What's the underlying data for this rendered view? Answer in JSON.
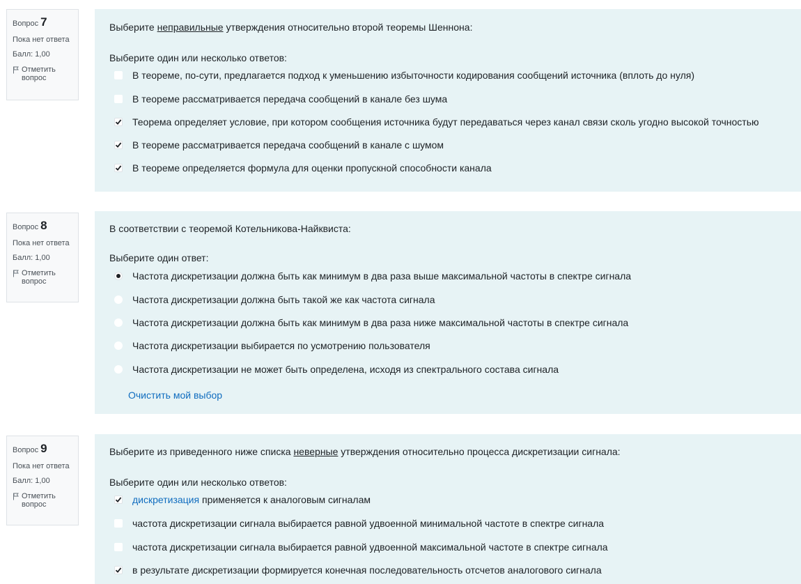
{
  "q7": {
    "question_word": "Вопрос",
    "number": "7",
    "status": "Пока нет ответа",
    "mark": "Балл: 1,00",
    "flag_line1": "Отметить",
    "flag_line2": "вопрос",
    "text_before": "Выберите ",
    "text_underlined": "неправильные",
    "text_after": " утверждения относительно второй теоремы Шеннона:",
    "prompt": "Выберите один или несколько ответов:",
    "options": [
      {
        "label": "В теореме, по-сути, предлагается подход к уменьшению избыточности кодирования сообщений источника (вплоть до нуля)",
        "checked": false
      },
      {
        "label": "В теореме рассматривается передача сообщений в канале без шума",
        "checked": false
      },
      {
        "label": "Теорема определяет условие, при котором сообщения источника будут передаваться через канал связи сколь угодно высокой точностью",
        "checked": true
      },
      {
        "label": "В теореме рассматривается передача сообщений в канале с шумом",
        "checked": true
      },
      {
        "label": "В теореме определяется формула для оценки пропускной способности канала",
        "checked": true
      }
    ]
  },
  "q8": {
    "question_word": "Вопрос",
    "number": "8",
    "status": "Пока нет ответа",
    "mark": "Балл: 1,00",
    "flag_line1": "Отметить",
    "flag_line2": "вопрос",
    "text": "В соответствии с теоремой Котельникова-Найквиста:",
    "prompt": "Выберите один ответ:",
    "options": [
      {
        "label": "Частота дискретизации должна быть как минимум в два раза выше максимальной частоты в спектре сигнала",
        "checked": true
      },
      {
        "label": "Частота дискретизации должна быть такой же как частота сигнала",
        "checked": false
      },
      {
        "label": "Частота дискретизации должна быть как минимум в два раза ниже максимальной частоты в спектре сигнала",
        "checked": false
      },
      {
        "label": "Частота дискретизации выбирается по усмотрению пользователя",
        "checked": false
      },
      {
        "label": "Частота дискретизации не может быть определена, исходя из спектрального состава сигнала",
        "checked": false
      }
    ],
    "clear_label": "Очистить мой выбор"
  },
  "q9": {
    "question_word": "Вопрос",
    "number": "9",
    "status": "Пока нет ответа",
    "mark": "Балл: 1,00",
    "flag_line1": "Отметить",
    "flag_line2": "вопрос",
    "text_before": "Выберите из приведенного ниже списка ",
    "text_underlined": "неверные",
    "text_after": " утверждения относительно процесса дискретизации сигнала:",
    "prompt": "Выберите один или несколько ответов:",
    "options": [
      {
        "link": "дискретизация",
        "label": " применяется к аналоговым сигналам",
        "checked": true
      },
      {
        "label": "частота дискретизации сигнала выбирается равной удвоенной минимальной частоте в спектре сигнала",
        "checked": false
      },
      {
        "label": "частота дискретизации сигнала выбирается равной удвоенной максимальной частоте в спектре сигнала",
        "checked": false
      },
      {
        "label": "в результате дискретизации формируется конечная последовательность отсчетов аналогового сигнала",
        "checked": true
      }
    ]
  },
  "colors": {
    "content_bg": "#e7f3f5",
    "info_bg": "#f8f9fa",
    "link": "#0f6cbf"
  }
}
